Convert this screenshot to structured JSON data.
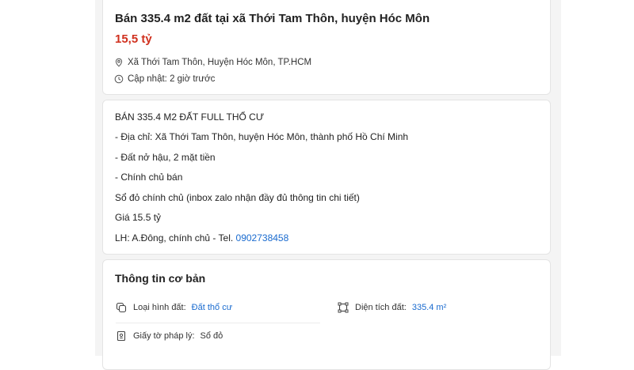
{
  "listing": {
    "title": "Bán 335.4 m2 đất tại xã Thới Tam Thôn, huyện Hóc Môn",
    "price": "15,5 tỷ",
    "location": "Xã Thới Tam Thôn, Huyện Hóc Môn, TP.HCM",
    "updated": "Cập nhật: 2 giờ trước"
  },
  "description": {
    "lines": [
      "BÁN 335.4 M2 ĐẤT FULL THỔ CƯ",
      "- Địa chỉ: Xã Thới Tam Thôn, huyện Hóc Môn, thành phố Hồ Chí Minh",
      "- Đất nở hậu, 2 mặt tiền",
      "- Chính chủ bán",
      "Sổ đỏ chính chủ (inbox zalo nhận đầy đủ thông tin chi tiết)",
      "Giá 15.5 tỷ"
    ],
    "contact_prefix": "LH: A.Đông, chính chủ - Tel. ",
    "phone": "0902738458"
  },
  "basic_info": {
    "title": "Thông tin cơ bản",
    "land_type_label": "Loại hình đất:",
    "land_type_value": "Đất thổ cư",
    "area_label": "Diện tích đất:",
    "area_value": "335.4 m²",
    "legal_label": "Giấy tờ pháp lý:",
    "legal_value": "Sổ đỏ"
  },
  "colors": {
    "price": "#d0301e",
    "link": "#1a6bcf",
    "background": "#f4f4f4"
  },
  "icons": [
    "location-pin-icon",
    "clock-icon",
    "land-type-icon",
    "area-icon",
    "document-icon"
  ]
}
